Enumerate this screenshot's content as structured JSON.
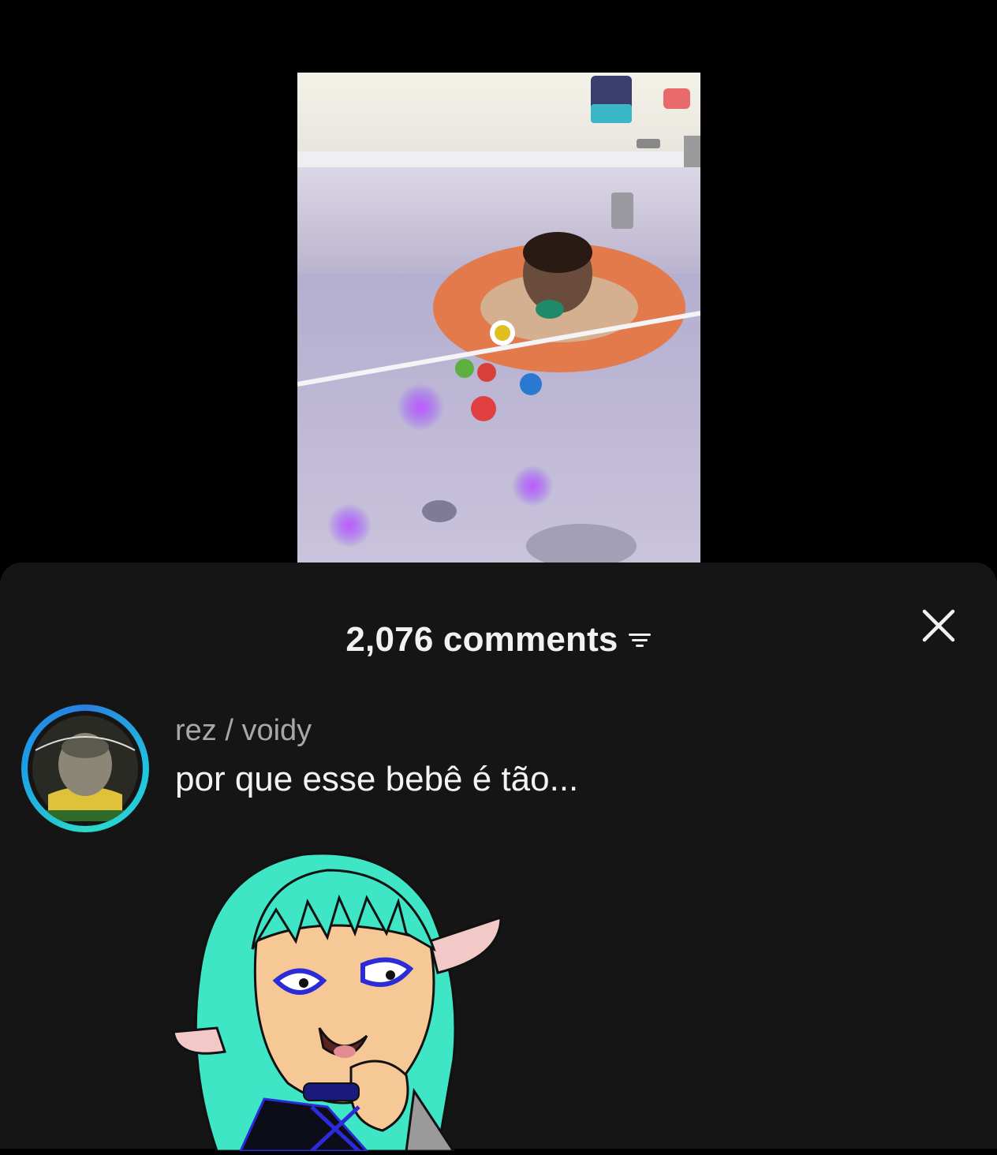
{
  "header": {
    "comments_count": "2,076 comments",
    "filter_icon": "filter-icon",
    "close_icon": "close-icon"
  },
  "comment": {
    "username": "rez / voidy",
    "text": "por que esse bebê é tão...",
    "has_sticker": true
  },
  "colors": {
    "sheet_bg": "#151516",
    "avatar_ring": "#1fc4e0",
    "sticker_hair": "#3fe6c6"
  }
}
